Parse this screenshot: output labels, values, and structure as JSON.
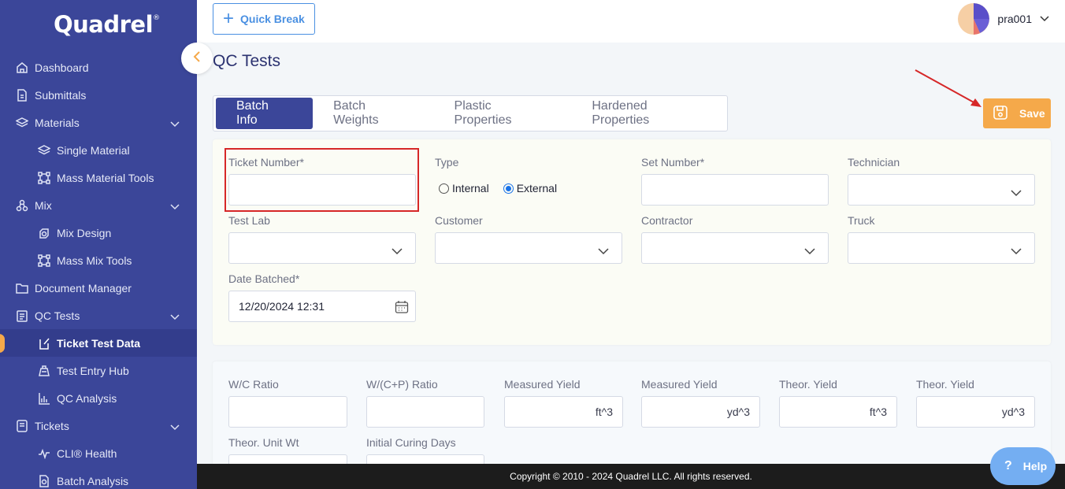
{
  "app": {
    "logo": "Quadrel",
    "logo_mark": "®"
  },
  "sidebar": {
    "items": [
      {
        "label": "Dashboard",
        "icon": "home-icon"
      },
      {
        "label": "Submittals",
        "icon": "document-icon"
      },
      {
        "label": "Materials",
        "icon": "layers-icon",
        "expandable": true
      },
      {
        "label": "Single Material",
        "icon": "layers-icon",
        "sub": true
      },
      {
        "label": "Mass Material Tools",
        "icon": "nodes-icon",
        "sub": true
      },
      {
        "label": "Mix",
        "icon": "mix-icon",
        "expandable": true
      },
      {
        "label": "Mix Design",
        "icon": "mixer-icon",
        "sub": true
      },
      {
        "label": "Mass Mix Tools",
        "icon": "nodes-icon",
        "sub": true
      },
      {
        "label": "Document Manager",
        "icon": "folder-icon"
      },
      {
        "label": "QC Tests",
        "icon": "clipboard-icon",
        "expandable": true
      },
      {
        "label": "Ticket Test Data",
        "icon": "edit-icon",
        "sub": true,
        "active": true
      },
      {
        "label": "Test Entry Hub",
        "icon": "hub-icon",
        "sub": true
      },
      {
        "label": "QC Analysis",
        "icon": "bar-chart-icon",
        "sub": true
      },
      {
        "label": "Tickets",
        "icon": "ticket-icon",
        "expandable": true
      },
      {
        "label": "CLI® Health",
        "icon": "health-icon",
        "sub": true
      },
      {
        "label": "Batch Analysis",
        "icon": "analysis-icon",
        "sub": true
      }
    ]
  },
  "topbar": {
    "quick_break_label": "Quick Break",
    "username": "pra001"
  },
  "page": {
    "title": "QC Tests",
    "tabs": [
      "Batch Info",
      "Batch Weights",
      "Plastic Properties",
      "Hardened Properties"
    ],
    "active_tab": "Batch Info",
    "save_label": "Save"
  },
  "batch_info": {
    "ticket_number": {
      "label": "Ticket Number*",
      "value": ""
    },
    "type": {
      "label": "Type",
      "options": [
        "Internal",
        "External"
      ],
      "selected": "External"
    },
    "set_number": {
      "label": "Set Number*",
      "value": ""
    },
    "technician": {
      "label": "Technician",
      "value": ""
    },
    "test_lab": {
      "label": "Test Lab",
      "value": ""
    },
    "customer": {
      "label": "Customer",
      "value": ""
    },
    "contractor": {
      "label": "Contractor",
      "value": ""
    },
    "truck": {
      "label": "Truck",
      "value": ""
    },
    "date_batched": {
      "label": "Date Batched*",
      "value": "12/20/2024 12:31"
    }
  },
  "computed": {
    "wc_ratio": {
      "label": "W/C Ratio",
      "value": ""
    },
    "wcp_ratio": {
      "label": "W/(C+P) Ratio",
      "value": ""
    },
    "measured_yield_ft": {
      "label": "Measured Yield",
      "unit": "ft^3"
    },
    "measured_yield_yd": {
      "label": "Measured Yield",
      "unit": "yd^3"
    },
    "theor_yield_ft": {
      "label": "Theor. Yield",
      "unit": "ft^3"
    },
    "theor_yield_yd": {
      "label": "Theor. Yield",
      "unit": "yd^3"
    },
    "theor_unit_wt": {
      "label": "Theor. Unit Wt"
    },
    "initial_curing_days": {
      "label": "Initial Curing Days"
    }
  },
  "footer": {
    "copyright": "Copyright © 2010 - 2024 Quadrel LLC. All rights reserved."
  },
  "help": {
    "label": "Help"
  },
  "colors": {
    "sidebar": "#3b4699",
    "accent": "#f5a94a",
    "primary": "#3b4699",
    "link": "#4a90e2",
    "annotation": "#d62728"
  }
}
